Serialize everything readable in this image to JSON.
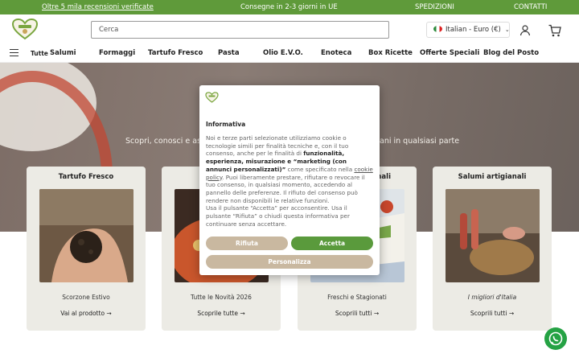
{
  "topbar": {
    "reviews": "Oltre 5 mila recensioni verificate",
    "delivery": "Consegne in 2-3 giorni in UE",
    "shipping": "SPEDIZIONI",
    "contact": "CONTATTI"
  },
  "header": {
    "search_placeholder": "Cerca",
    "language": "Italian - Euro (€)"
  },
  "nav": {
    "all": "Tutte",
    "items": [
      "Salumi",
      "Formaggi",
      "Tartufo Fresco",
      "Pasta",
      "Olio E.V.O.",
      "Enoteca",
      "Box Ricette",
      "Offerte Speciali",
      "Blog del Posto"
    ]
  },
  "hero": {
    "tagline_left": "Scopri, conosci e ass",
    "tagline_right": "ani in qualsiasi parte"
  },
  "cards": [
    {
      "title": "Tartufo Fresco",
      "subtitle": "Scorzone Estivo",
      "link": "Vai al prodotto"
    },
    {
      "title": "",
      "subtitle": "Tutte le Novità 2026",
      "link": "Scoprile tutte"
    },
    {
      "title": "nali",
      "subtitle": "Freschi e Stagionati",
      "link": "Scoprili tutti"
    },
    {
      "title": "Salumi artigianali",
      "subtitle": "I migliori d'Italia",
      "link": "Scoprili tutti"
    }
  ],
  "modal": {
    "title": "Informativa",
    "p1_a": "Noi e terze parti selezionate utilizziamo cookie o tecnologie simili per finalità tecniche e, con il tuo consenso, anche per le finalità di ",
    "p1_b": "funzionalità, esperienza, misurazione e “marketing (con annunci personalizzati)”",
    "p1_c": " come specificato nella ",
    "p1_link": "cookie policy",
    "p1_d": ". Puoi liberamente prestare, rifiutare o revocare il tuo consenso, in qualsiasi momento, accedendo al pannello delle preferenze. Il rifiuto del consenso può rendere non disponibili le relative funzioni.",
    "p2": "Usa il pulsante “Accetta” per acconsentire. Usa il pulsante “Rifiuta” o chiudi questa informativa per continuare senza accettare.",
    "reject": "Rifiuta",
    "accept": "Accetta",
    "customize": "Personalizza"
  },
  "colors": {
    "topbar": "#5f9a3a",
    "accept": "#5a9a3c",
    "secondary_button": "#c9b8a0",
    "card_bg": "#ecebe5",
    "whatsapp": "#25a244"
  },
  "icons": [
    "logo-heart-icon",
    "user-icon",
    "cart-icon",
    "hamburger-icon",
    "arrow-right-icon",
    "whatsapp-icon"
  ]
}
